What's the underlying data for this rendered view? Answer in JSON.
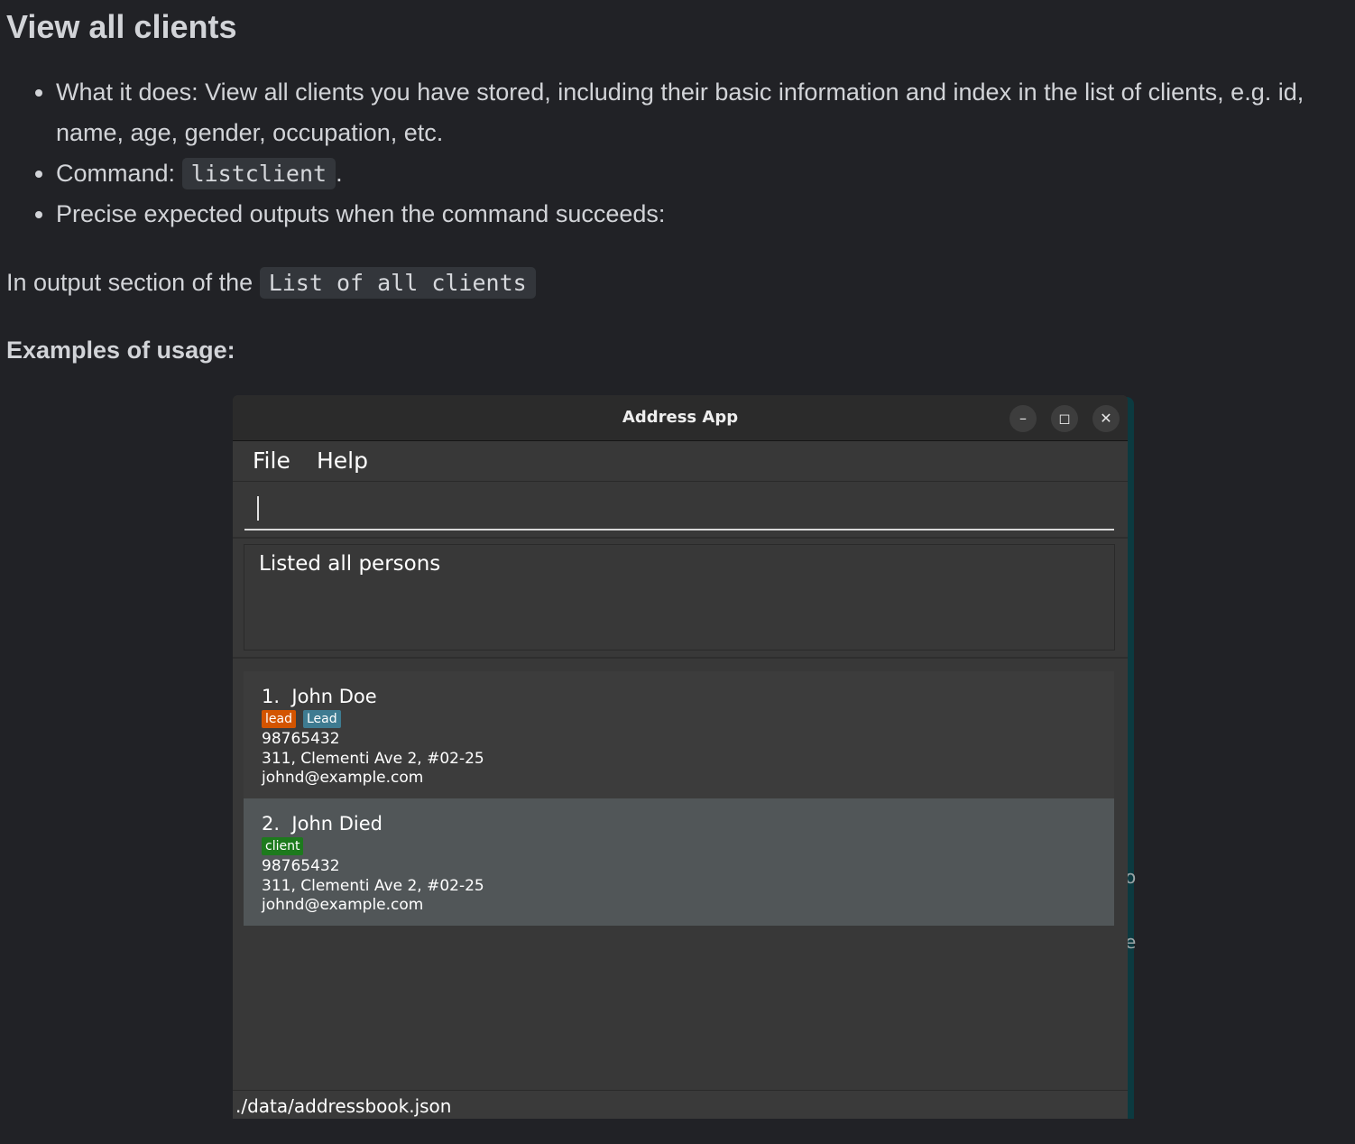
{
  "doc": {
    "heading": "View all clients",
    "bullets": [
      {
        "text": "What it does: View all clients you have stored, including their basic information and index in the list of clients, e.g. id, name, age, gender, occupation, etc."
      },
      {
        "prefix": "Command: ",
        "code": "listclient",
        "suffix": "."
      },
      {
        "text": "Precise expected outputs when the command succeeds:"
      }
    ],
    "output_prefix": "In output section of the ",
    "output_code": "List of all clients",
    "examples_heading": "Examples of usage:"
  },
  "app": {
    "title": "Address App",
    "window_buttons": {
      "minimize": "–",
      "maximize": "◻",
      "close": "✕"
    },
    "menu": [
      "File",
      "Help"
    ],
    "command_input": {
      "value": "",
      "placeholder": ""
    },
    "result_text": "Listed all persons",
    "persons": [
      {
        "index": "1.",
        "name": "John Doe",
        "tags": [
          {
            "label": "lead",
            "color": "#d35400"
          },
          {
            "label": "Lead",
            "color": "#3e7b91"
          }
        ],
        "phone": "98765432",
        "address": "311, Clementi Ave 2, #02-25",
        "email": "johnd@example.com"
      },
      {
        "index": "2.",
        "name": "John Died",
        "tags": [
          {
            "label": "client",
            "color": "#1d7a1d"
          }
        ],
        "phone": "98765432",
        "address": "311, Clementi Ave 2, #02-25",
        "email": "johnd@example.com"
      }
    ],
    "status_path": "./data/addressbook.json"
  },
  "background_glyphs": [
    "o",
    "e"
  ]
}
